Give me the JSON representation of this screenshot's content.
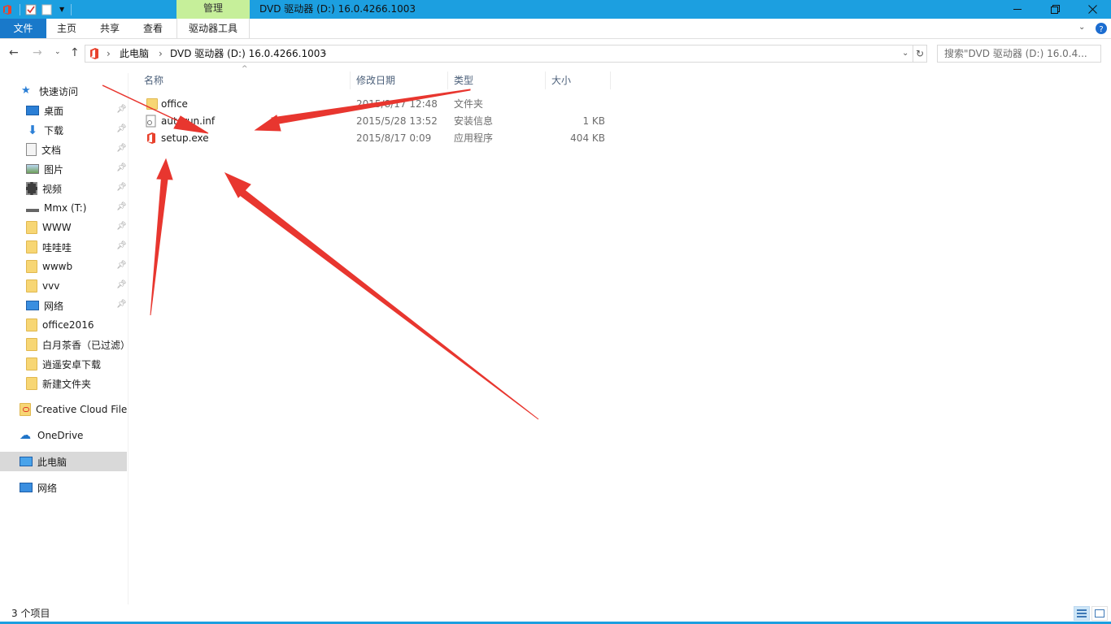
{
  "window": {
    "title": "DVD 驱动器 (D:) 16.0.4266.1003",
    "contextual_tab": "管理",
    "minimize_icon": "minimize-icon",
    "restore_icon": "restore-icon",
    "close_icon": "close-icon"
  },
  "ribbon": {
    "tabs": [
      "文件",
      "主页",
      "共享",
      "查看"
    ],
    "context_tool": "驱动器工具"
  },
  "address": {
    "crumbs": [
      "此电脑",
      "DVD 驱动器 (D:) 16.0.4266.1003"
    ],
    "search_placeholder": "搜索\"DVD 驱动器 (D:) 16.0.4..."
  },
  "nav": {
    "quick_access": "快速访问",
    "pinned": [
      {
        "label": "桌面",
        "icon": "desktop-icon"
      },
      {
        "label": "下载",
        "icon": "download-icon"
      },
      {
        "label": "文档",
        "icon": "documents-icon"
      },
      {
        "label": "图片",
        "icon": "pictures-icon"
      },
      {
        "label": "视频",
        "icon": "videos-icon"
      },
      {
        "label": "Mmx (T:)",
        "icon": "drive-icon"
      },
      {
        "label": "WWW",
        "icon": "folder-icon"
      },
      {
        "label": "哇哇哇",
        "icon": "folder-icon"
      },
      {
        "label": "wwwb",
        "icon": "folder-icon"
      },
      {
        "label": "vvv",
        "icon": "folder-icon"
      },
      {
        "label": "网络",
        "icon": "network-icon"
      }
    ],
    "recent": [
      {
        "label": "office2016",
        "icon": "folder-icon"
      },
      {
        "label": "白月茶香（已过滤）",
        "icon": "folder-icon"
      },
      {
        "label": "逍遥安卓下载",
        "icon": "folder-icon"
      },
      {
        "label": "新建文件夹",
        "icon": "folder-icon"
      }
    ],
    "creative_cloud": "Creative Cloud Files",
    "onedrive": "OneDrive",
    "this_pc": "此电脑",
    "network": "网络"
  },
  "columns": {
    "name": "名称",
    "modified": "修改日期",
    "type": "类型",
    "size": "大小"
  },
  "files": [
    {
      "name": "office",
      "modified": "2015/8/17 12:48",
      "type": "文件夹",
      "size": "",
      "icon": "folder-icon"
    },
    {
      "name": "autorun.inf",
      "modified": "2015/5/28 13:52",
      "type": "安装信息",
      "size": "1 KB",
      "icon": "settings-file-icon"
    },
    {
      "name": "setup.exe",
      "modified": "2015/8/17 0:09",
      "type": "应用程序",
      "size": "404 KB",
      "icon": "office-logo-icon"
    }
  ],
  "status": {
    "item_count": "3 个项目"
  },
  "colors": {
    "titlebar": "#1c9fe0",
    "file_tab": "#1979ca",
    "manage_tab": "#c6ef9a",
    "annotation_arrow": "#e8362f"
  }
}
